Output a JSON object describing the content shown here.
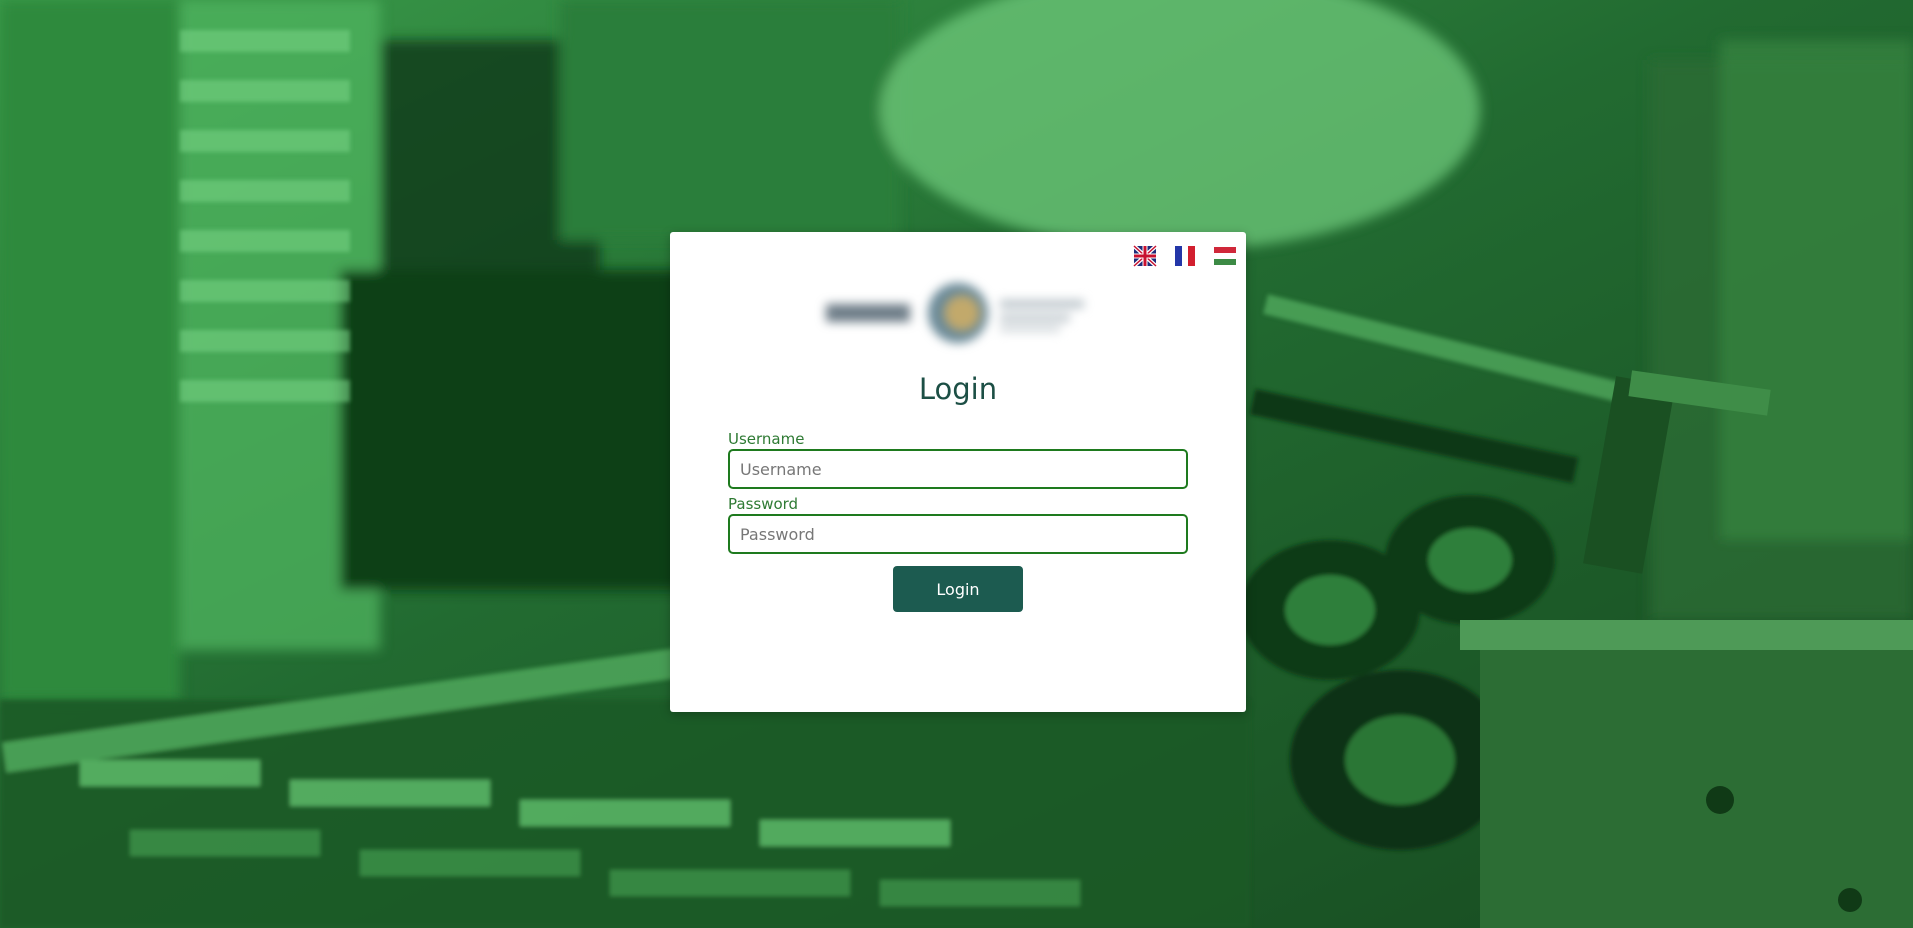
{
  "languages": [
    {
      "code": "en",
      "icon": "uk-flag-icon"
    },
    {
      "code": "fr",
      "icon": "france-flag-icon"
    },
    {
      "code": "hu",
      "icon": "hungary-flag-icon"
    }
  ],
  "login": {
    "title": "Login",
    "username_label": "Username",
    "username_placeholder": "Username",
    "username_value": "",
    "password_label": "Password",
    "password_placeholder": "Password",
    "password_value": "",
    "submit_label": "Login"
  },
  "colors": {
    "accent": "#1c5b50",
    "field_border": "#1e7a1e",
    "label_green": "#2e7a33",
    "background_tint": "#2f8f3f"
  }
}
